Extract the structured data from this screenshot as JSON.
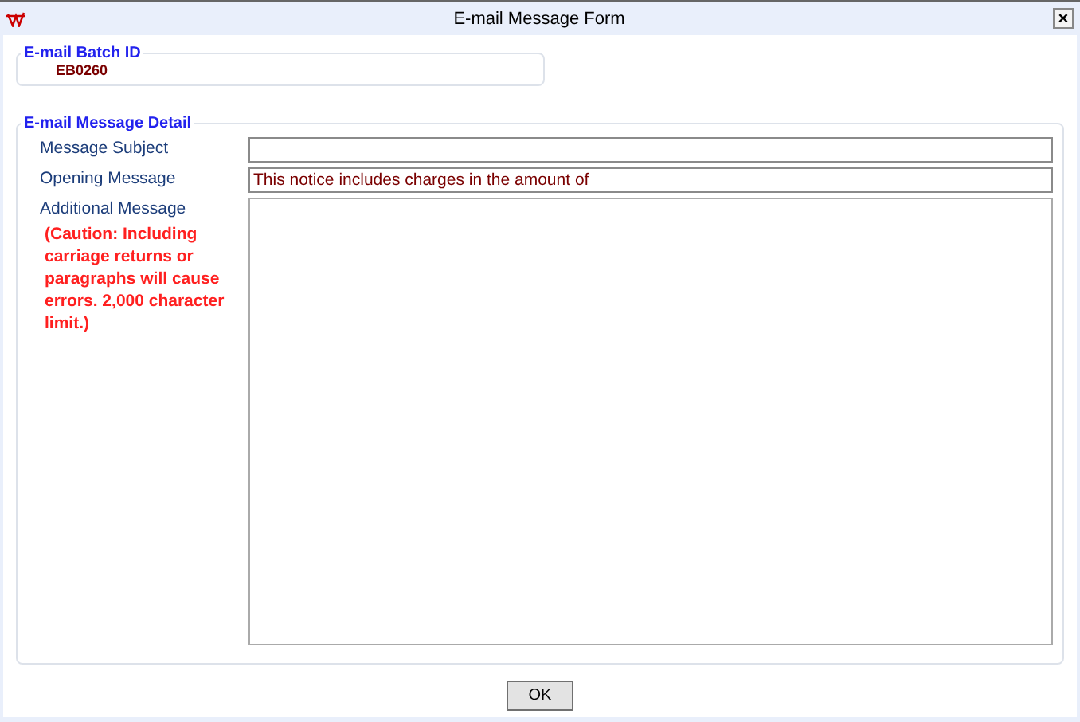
{
  "window": {
    "title": "E-mail Message Form",
    "close": "×"
  },
  "batch": {
    "legend": "E-mail Batch ID",
    "value": "EB0260"
  },
  "detail": {
    "legend": "E-mail Message Detail",
    "fields": [
      {
        "label": "Message Subject",
        "kind": "line"
      },
      {
        "label": "Opening Message",
        "kind": "line",
        "value": "This notice includes charges in the amount of"
      },
      {
        "label": "Additional Message",
        "kind": "area",
        "caution": "(Caution:  Including carriage returns or paragraphs will cause errors. 2,000 character limit.)"
      }
    ]
  },
  "buttons": [
    "OK"
  ]
}
